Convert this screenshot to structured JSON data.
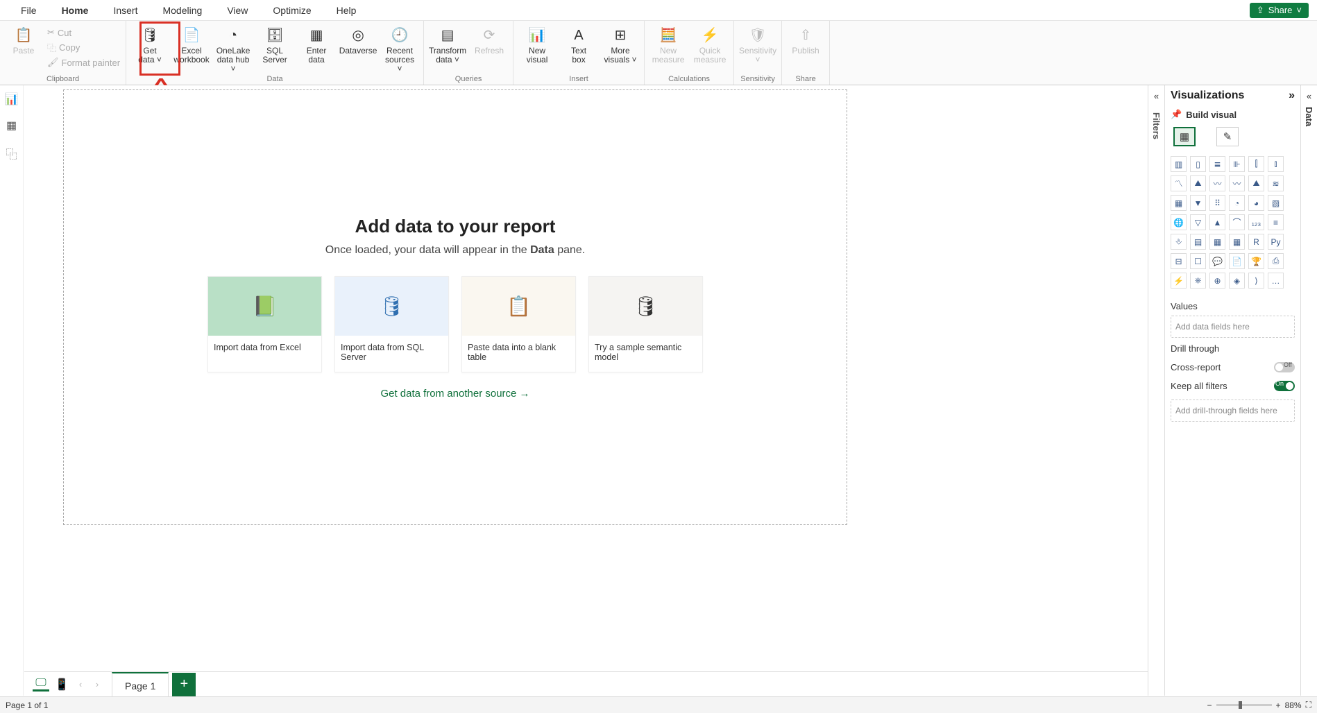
{
  "menubar": {
    "tabs": [
      "File",
      "Home",
      "Insert",
      "Modeling",
      "View",
      "Optimize",
      "Help"
    ],
    "active": "Home",
    "share": "Share"
  },
  "ribbon": {
    "clipboard": {
      "name": "Clipboard",
      "paste": "Paste",
      "cut": "Cut",
      "copy": "Copy",
      "format": "Format painter"
    },
    "data": {
      "name": "Data",
      "items": [
        {
          "label1": "Get",
          "label2": "data",
          "drop": true,
          "icon": "🛢"
        },
        {
          "label1": "Excel",
          "label2": "workbook",
          "icon": "📄"
        },
        {
          "label1": "OneLake",
          "label2": "data hub",
          "drop": true,
          "icon": "◔"
        },
        {
          "label1": "SQL",
          "label2": "Server",
          "icon": "🗄"
        },
        {
          "label1": "Enter",
          "label2": "data",
          "icon": "▦"
        },
        {
          "label1": "Dataverse",
          "label2": "",
          "icon": "◎"
        },
        {
          "label1": "Recent",
          "label2": "sources",
          "drop": true,
          "icon": "🕘"
        }
      ]
    },
    "queries": {
      "name": "Queries",
      "items": [
        {
          "label1": "Transform",
          "label2": "data",
          "drop": true,
          "icon": "▤"
        },
        {
          "label1": "Refresh",
          "label2": "",
          "icon": "⟳",
          "disabled": true
        }
      ]
    },
    "insert": {
      "name": "Insert",
      "items": [
        {
          "label1": "New",
          "label2": "visual",
          "icon": "📊"
        },
        {
          "label1": "Text",
          "label2": "box",
          "icon": "A"
        },
        {
          "label1": "More",
          "label2": "visuals",
          "drop": true,
          "icon": "⊞"
        }
      ]
    },
    "calculations": {
      "name": "Calculations",
      "items": [
        {
          "label1": "New",
          "label2": "measure",
          "icon": "🧮",
          "disabled": true
        },
        {
          "label1": "Quick",
          "label2": "measure",
          "icon": "⚡",
          "disabled": true
        }
      ]
    },
    "sensitivity": {
      "name": "Sensitivity",
      "items": [
        {
          "label1": "Sensitivity",
          "label2": "",
          "drop": true,
          "icon": "🛡",
          "disabled": true
        }
      ]
    },
    "share": {
      "name": "Share",
      "items": [
        {
          "label1": "Publish",
          "label2": "",
          "icon": "⇧",
          "disabled": true
        }
      ]
    }
  },
  "canvas": {
    "title": "Add data to your report",
    "subtitle_pre": "Once loaded, your data will appear in the ",
    "subtitle_bold": "Data",
    "subtitle_post": " pane.",
    "cards": [
      {
        "label": "Import data from Excel",
        "icon": "X",
        "bg": "#b9e0c6",
        "iconcolor": "#107c41"
      },
      {
        "label": "Import data from SQL Server",
        "icon": "SQL",
        "bg": "#e9f1fb",
        "iconcolor": "#2f6fb0"
      },
      {
        "label": "Paste data into a blank table",
        "icon": "📋",
        "bg": "#faf7f0"
      },
      {
        "label": "Try a sample semantic model",
        "icon": "🛢",
        "bg": "#f5f4f2"
      }
    ],
    "another": "Get data from another source →"
  },
  "pagetabs": {
    "page": "Page 1"
  },
  "statusbar": {
    "page": "Page 1 of 1",
    "zoom": "88%"
  },
  "viz": {
    "title": "Visualizations",
    "build": "Build visual",
    "values": "Values",
    "values_ph": "Add data fields here",
    "drill": "Drill through",
    "cross": "Cross-report",
    "cross_state": "Off",
    "keep": "Keep all filters",
    "keep_state": "On",
    "drill_ph": "Add drill-through fields here",
    "icons": [
      "▥",
      "▯",
      "≣",
      "⊪",
      "⫿",
      "⫾",
      "〽",
      "⛰",
      "〰",
      "〰",
      "⛰",
      "≋",
      "▦",
      "▼",
      "⠿",
      "◔",
      "◕",
      "▧",
      "🌐",
      "▽",
      "▲",
      "⌒",
      "₁₂₃",
      "≡",
      "⎀",
      "▤",
      "▦",
      "▦",
      "R",
      "Py",
      "⊟",
      "☐",
      "💬",
      "📄",
      "🏆",
      "⎙",
      "⚡",
      "⎈",
      "⊕",
      "◈",
      "⟩",
      "…"
    ]
  },
  "panes": {
    "filters": "Filters",
    "data": "Data"
  }
}
